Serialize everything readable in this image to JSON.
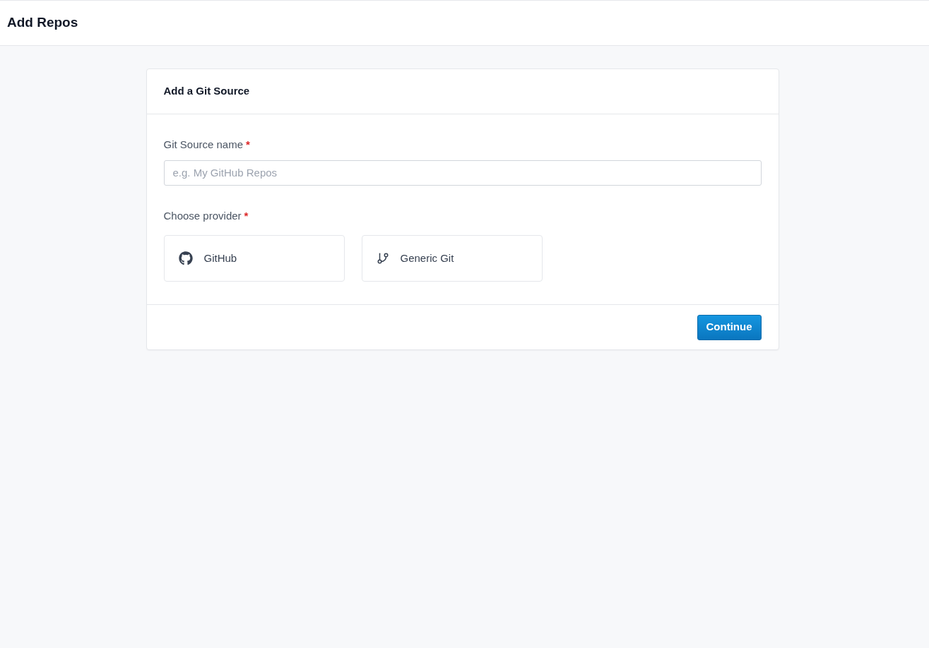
{
  "page": {
    "title": "Add Repos"
  },
  "card": {
    "title": "Add a Git Source",
    "name_field": {
      "label": "Git Source name",
      "required_mark": "*",
      "placeholder": "e.g. My GitHub Repos"
    },
    "provider_field": {
      "label": "Choose provider",
      "required_mark": "*",
      "options": [
        {
          "kind": "github",
          "label": "GitHub",
          "selected": false
        },
        {
          "kind": "git",
          "label": "Generic Git",
          "selected": false
        }
      ]
    },
    "footer": {
      "button": "Continue"
    }
  }
}
